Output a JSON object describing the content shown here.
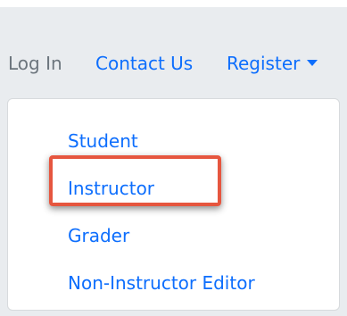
{
  "navbar": {
    "login_label": "Log In",
    "contact_label": "Contact Us",
    "register_label": "Register"
  },
  "register_menu": {
    "items": [
      {
        "label": "Student"
      },
      {
        "label": "Instructor"
      },
      {
        "label": "Grader"
      },
      {
        "label": "Non-Instructor Editor"
      }
    ],
    "highlighted_item": "Instructor"
  },
  "colors": {
    "link": "#0d6efd",
    "muted_text": "#6c757d",
    "navbar_bg": "#e9ecef",
    "highlight": "#e6563f"
  },
  "icons": {
    "register_caret": "caret-down-icon"
  }
}
